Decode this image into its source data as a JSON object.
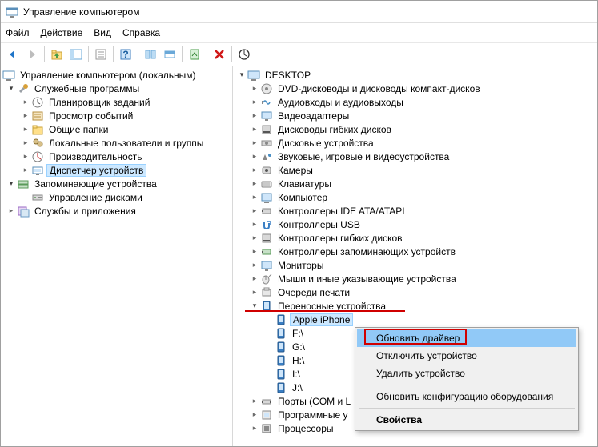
{
  "window": {
    "title": "Управление компьютером"
  },
  "menu": {
    "file": "Файл",
    "action": "Действие",
    "view": "Вид",
    "help": "Справка"
  },
  "left_tree": {
    "root": "Управление компьютером (локальным)",
    "g1": "Служебные программы",
    "g1_items": [
      "Планировщик заданий",
      "Просмотр событий",
      "Общие папки",
      "Локальные пользователи и группы",
      "Производительность",
      "Диспетчер устройств"
    ],
    "g2": "Запоминающие устройства",
    "g2_items": [
      "Управление дисками"
    ],
    "g3": "Службы и приложения"
  },
  "right_tree": {
    "root": "DESKTOP",
    "cats": [
      "DVD-дисководы и дисководы компакт-дисков",
      "Аудиовходы и аудиовыходы",
      "Видеоадаптеры",
      "Дисководы гибких дисков",
      "Дисковые устройства",
      "Звуковые, игровые и видеоустройства",
      "Камеры",
      "Клавиатуры",
      "Компьютер",
      "Контроллеры IDE ATA/ATAPI",
      "Контроллеры USB",
      "Контроллеры гибких дисков",
      "Контроллеры запоминающих устройств",
      "Мониторы",
      "Мыши и иные указывающие устройства",
      "Очереди печати"
    ],
    "portable": "Переносные устройства",
    "portable_items": [
      "Apple iPhone",
      "F:\\",
      "G:\\",
      "H:\\",
      "I:\\",
      "J:\\"
    ],
    "tail": [
      "Порты (COM и L",
      "Программные у",
      "Процессоры"
    ]
  },
  "ctx": {
    "update": "Обновить драйвер",
    "disable": "Отключить устройство",
    "uninstall": "Удалить устройство",
    "scan": "Обновить конфигурацию оборудования",
    "props": "Свойства"
  }
}
